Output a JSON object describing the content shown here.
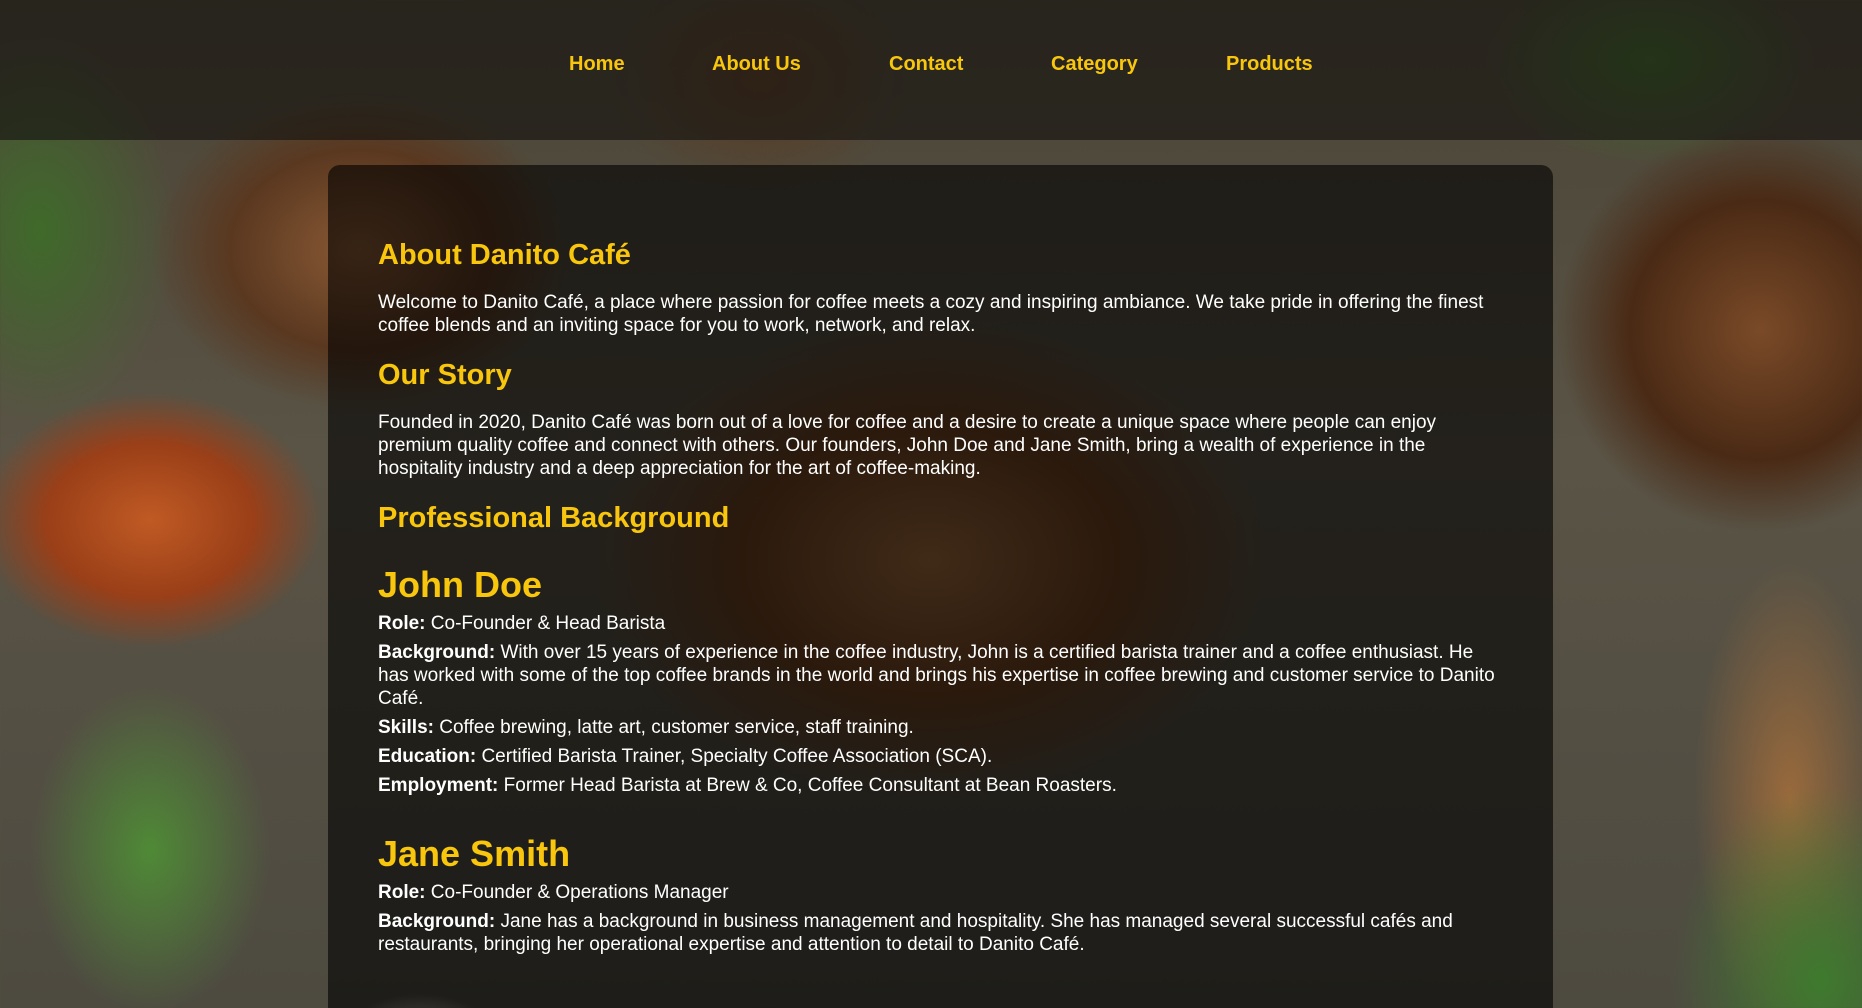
{
  "nav": {
    "items": [
      {
        "label": "Home"
      },
      {
        "label": "About Us"
      },
      {
        "label": "Contact"
      },
      {
        "label": "Category"
      },
      {
        "label": "Products"
      }
    ]
  },
  "about": {
    "title": "About Danito Café",
    "text": "Welcome to Danito Café, a place where passion for coffee meets a cozy and inspiring ambiance. We take pride in offering the finest coffee blends and an inviting space for you to work, network, and relax."
  },
  "story": {
    "title": "Our Story",
    "text": "Founded in 2020, Danito Café was born out of a love for coffee and a desire to create a unique space where people can enjoy premium quality coffee and connect with others. Our founders, John Doe and Jane Smith, bring a wealth of experience in the hospitality industry and a deep appreciation for the art of coffee-making."
  },
  "background_section": {
    "title": "Professional Background"
  },
  "people": [
    {
      "name": "John Doe",
      "details": [
        {
          "label": "Role:",
          "value": "Co-Founder & Head Barista"
        },
        {
          "label": "Background:",
          "value": "With over 15 years of experience in the coffee industry, John is a certified barista trainer and a coffee enthusiast. He has worked with some of the top coffee brands in the world and brings his expertise in coffee brewing and customer service to Danito Café."
        },
        {
          "label": "Skills:",
          "value": "Coffee brewing, latte art, customer service, staff training."
        },
        {
          "label": "Education:",
          "value": "Certified Barista Trainer, Specialty Coffee Association (SCA)."
        },
        {
          "label": "Employment:",
          "value": "Former Head Barista at Brew & Co, Coffee Consultant at Bean Roasters."
        }
      ]
    },
    {
      "name": "Jane Smith",
      "details": [
        {
          "label": "Role:",
          "value": "Co-Founder & Operations Manager"
        },
        {
          "label": "Background:",
          "value": "Jane has a background in business management and hospitality. She has managed several successful cafés and restaurants, bringing her operational expertise and attention to detail to Danito Café."
        }
      ]
    }
  ],
  "colors": {
    "accent": "#f7c60d",
    "text": "#ffffff",
    "panel": "rgba(0,0,0,0.6)"
  }
}
